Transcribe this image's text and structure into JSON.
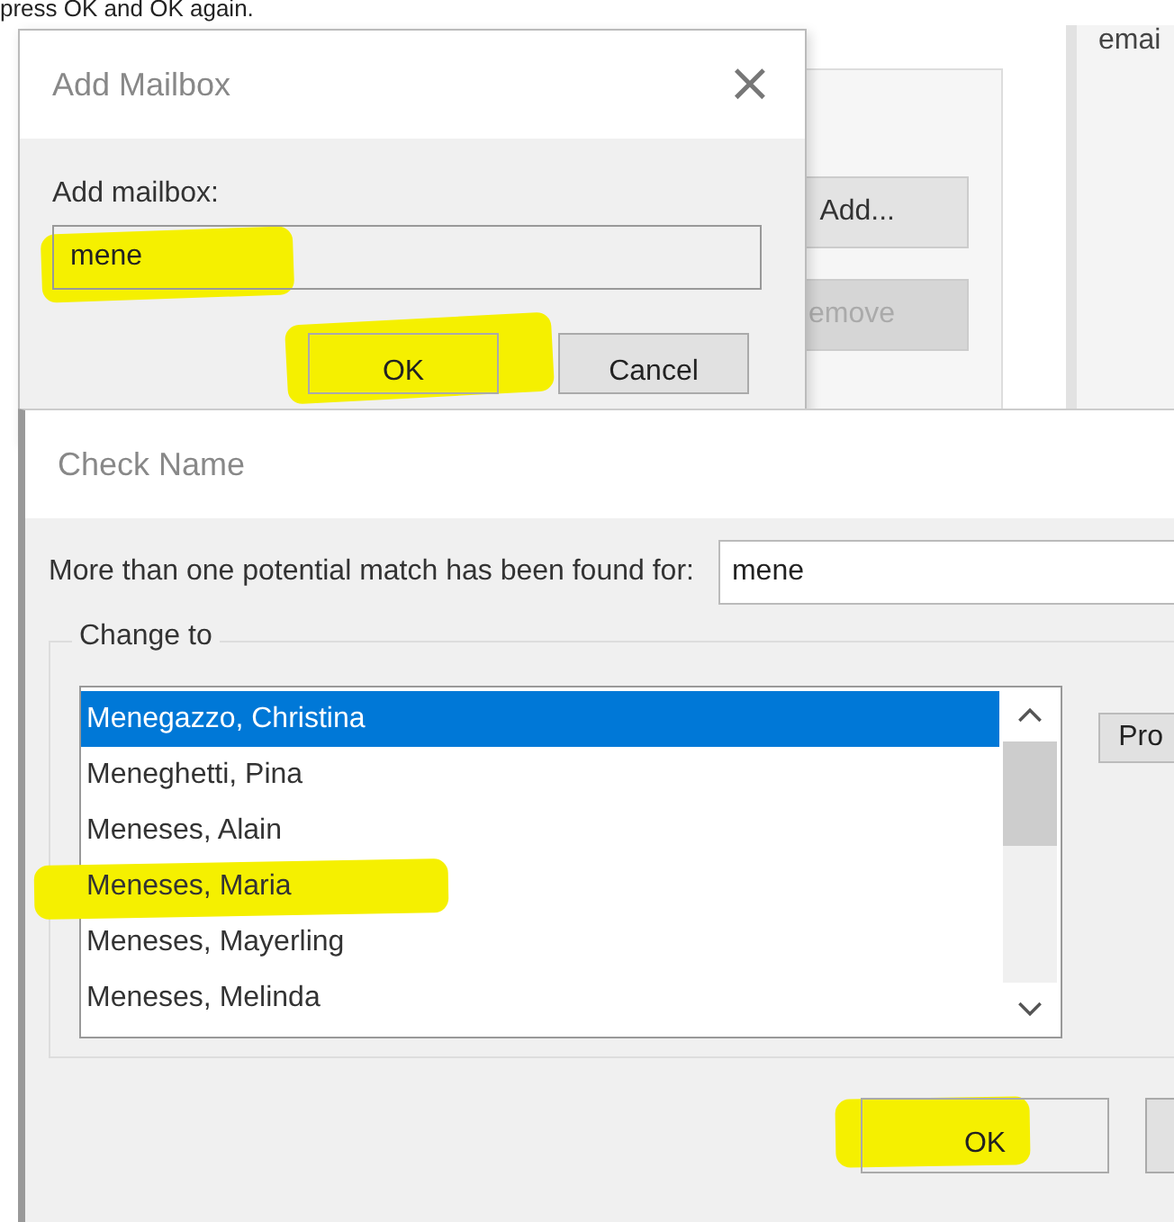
{
  "instruction": "press OK and OK again.",
  "background_window": {
    "column_text": "emai",
    "buttons": [
      {
        "label": "Add...",
        "disabled": false
      },
      {
        "label": "emove",
        "disabled": true
      }
    ]
  },
  "add_mailbox_dialog": {
    "title": "Add Mailbox",
    "close": "×",
    "field_label": "Add mailbox:",
    "field": {
      "value": "mene",
      "highlighted": true
    },
    "buttons": [
      {
        "label": "OK",
        "highlighted": true
      },
      {
        "label": "Cancel",
        "highlighted": false
      }
    ]
  },
  "check_name_dialog": {
    "title": "Check Name",
    "message": "More than one potential match has been found for:",
    "search_value": "mene",
    "group_label": "Change to",
    "matches": [
      {
        "name": "Menegazzo, Christina",
        "selected": true,
        "highlighted": false
      },
      {
        "name": "Meneghetti, Pina",
        "selected": false,
        "highlighted": false
      },
      {
        "name": "Meneses, Alain",
        "selected": false,
        "highlighted": false
      },
      {
        "name": "Meneses, Maria",
        "selected": false,
        "highlighted": true
      },
      {
        "name": "Meneses, Mayerling",
        "selected": false,
        "highlighted": false
      },
      {
        "name": "Meneses, Melinda",
        "selected": false,
        "highlighted": false
      }
    ],
    "side_button": "Pro",
    "buttons": [
      {
        "label": "OK",
        "highlighted": true
      },
      {
        "highlighted": false
      }
    ]
  }
}
